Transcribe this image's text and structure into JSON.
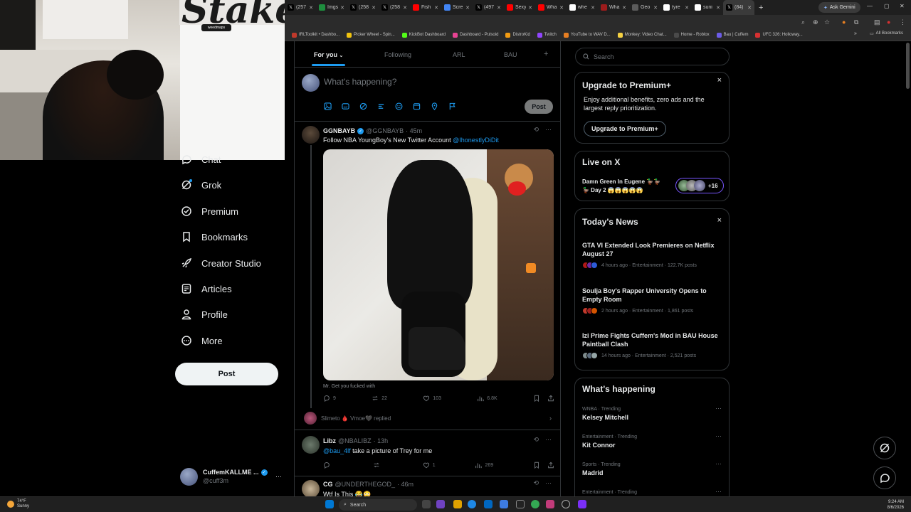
{
  "browser": {
    "tabs": [
      {
        "label": "(257",
        "icon": "x-icon",
        "color": "#000000"
      },
      {
        "label": "Imgs",
        "icon": "sheets-icon",
        "color": "#1e8e3e"
      },
      {
        "label": "(258",
        "icon": "x-icon",
        "color": "#000000"
      },
      {
        "label": "(258",
        "icon": "x-icon",
        "color": "#000000"
      },
      {
        "label": "Fish",
        "icon": "youtube-icon",
        "color": "#ff0000"
      },
      {
        "label": "Scre",
        "icon": "docs-icon",
        "color": "#4285f4"
      },
      {
        "label": "(497",
        "icon": "x-icon",
        "color": "#000000"
      },
      {
        "label": "Sexy",
        "icon": "youtube-icon",
        "color": "#ff0000"
      },
      {
        "label": "Wha",
        "icon": "youtube-icon",
        "color": "#ff0000"
      },
      {
        "label": "whe",
        "icon": "google-icon",
        "color": "#ffffff"
      },
      {
        "label": "Wha",
        "icon": "site-icon",
        "color": "#9c1c1c"
      },
      {
        "label": "Geo",
        "icon": "site-icon",
        "color": "#5b5b5b"
      },
      {
        "label": "tyre",
        "icon": "google-icon",
        "color": "#ffffff"
      },
      {
        "label": "suni",
        "icon": "google-icon",
        "color": "#ffffff"
      },
      {
        "label": "(84)",
        "icon": "x-icon",
        "color": "#000000",
        "active": true
      }
    ],
    "new_tab": "+",
    "gemini_label": "Ask Gemini",
    "bookmarks": [
      {
        "label": "IRLToolkit • Dashbo...",
        "color": "#c0392b"
      },
      {
        "label": "Picker Wheel - Spin...",
        "color": "#f1c40f"
      },
      {
        "label": "KickBot Dashboard",
        "color": "#53fc18"
      },
      {
        "label": "Dashboard - Pulsoid",
        "color": "#e84393"
      },
      {
        "label": "DistroKid",
        "color": "#f39c12"
      },
      {
        "label": "Twitch",
        "color": "#9146ff"
      },
      {
        "label": "YouTube to WAV D...",
        "color": "#e67e22"
      },
      {
        "label": "Monkey: Video Chat...",
        "color": "#f5d142"
      },
      {
        "label": "Home - Roblox",
        "color": "#4a4a4a"
      },
      {
        "label": "Bau | Cuffem",
        "color": "#6c5ce7"
      },
      {
        "label": "UFC 326: Holloway...",
        "color": "#d63031"
      }
    ],
    "all_bookmarks": "All Bookmarks"
  },
  "webcam": {
    "sign_text": "Stake",
    "sign_sub": "weedmaps"
  },
  "nav": {
    "items": [
      {
        "label": "Chat",
        "icon": "chat-icon"
      },
      {
        "label": "Grok",
        "icon": "grok-icon"
      },
      {
        "label": "Premium",
        "icon": "premium-icon"
      },
      {
        "label": "Bookmarks",
        "icon": "bookmark-icon"
      },
      {
        "label": "Creator Studio",
        "icon": "rocket-icon"
      },
      {
        "label": "Articles",
        "icon": "articles-icon"
      },
      {
        "label": "Profile",
        "icon": "profile-icon"
      },
      {
        "label": "More",
        "icon": "more-icon"
      }
    ],
    "post_label": "Post",
    "account_name": "CuffemKALLME ...",
    "account_handle": "@cuff3m",
    "account_more": "···"
  },
  "feed": {
    "tabs": [
      "For you",
      "Following",
      "ARL",
      "BAU"
    ],
    "add_tab": "+",
    "composer_placeholder": "What's happening?",
    "composer_post": "Post",
    "tweets": [
      {
        "name": "GGNBAYB",
        "handle": "@GGNBAYB",
        "time": "· 45m",
        "text": "Follow NBA YoungBoy's New Twitter Account ",
        "mention": "@IhonestlyDiDit",
        "caption": "Mr. Get you fucked with",
        "replies": "9",
        "reposts": "22",
        "likes": "103",
        "views": "6.8K",
        "replied_by": "Slimeto 🩸 Vmoe🖤 replied"
      },
      {
        "name": "Libz",
        "handle": "@NBALIBZ",
        "time": "· 13h",
        "mention": "@bau_4lf",
        "text": " take a picture of Trey for me",
        "replies": "",
        "reposts": "",
        "likes": "1",
        "views": "269"
      },
      {
        "name": "CG",
        "handle": "@UNDERTHEGOD_",
        "time": "· 46m",
        "text": "Wtf Is This 😂😳"
      }
    ]
  },
  "sidebar": {
    "search_placeholder": "Search",
    "premium": {
      "title": "Upgrade to Premium+",
      "body": "Enjoy additional benefits, zero ads and the largest reply prioritization.",
      "button": "Upgrade to Premium+",
      "close": "×"
    },
    "live": {
      "title": "Live on X",
      "stream": "Damn Green In Eugene 🦆🦆🦆 Day 2 😱😱😱😱😱",
      "count": "+16"
    },
    "news": {
      "title": "Today's News",
      "close": "×",
      "items": [
        {
          "title": "GTA VI Extended Look Premieres on Netflix August 27",
          "meta": "4 hours ago · Entertainment · 122.7K posts"
        },
        {
          "title": "Soulja Boy's Rapper University Opens to Empty Room",
          "meta": "2 hours ago · Entertainment · 1,861 posts"
        },
        {
          "title": "Izi Prime Fights Cuffem's Mod in BAU House Paintball Clash",
          "meta": "14 hours ago · Entertainment · 2,521 posts"
        }
      ]
    },
    "happening": {
      "title": "What's happening",
      "items": [
        {
          "category": "WNBA · Trending",
          "name": "Kelsey Mitchell"
        },
        {
          "category": "Entertainment · Trending",
          "name": "Kit Connor"
        },
        {
          "category": "Sports · Trending",
          "name": "Madrid"
        },
        {
          "category": "Entertainment · Trending",
          "name": ""
        }
      ]
    }
  },
  "taskbar": {
    "weather_temp": "74°F",
    "weather_desc": "Sunny",
    "search_label": "Search",
    "time": "9:24 AM",
    "date": "8/6/2026"
  }
}
